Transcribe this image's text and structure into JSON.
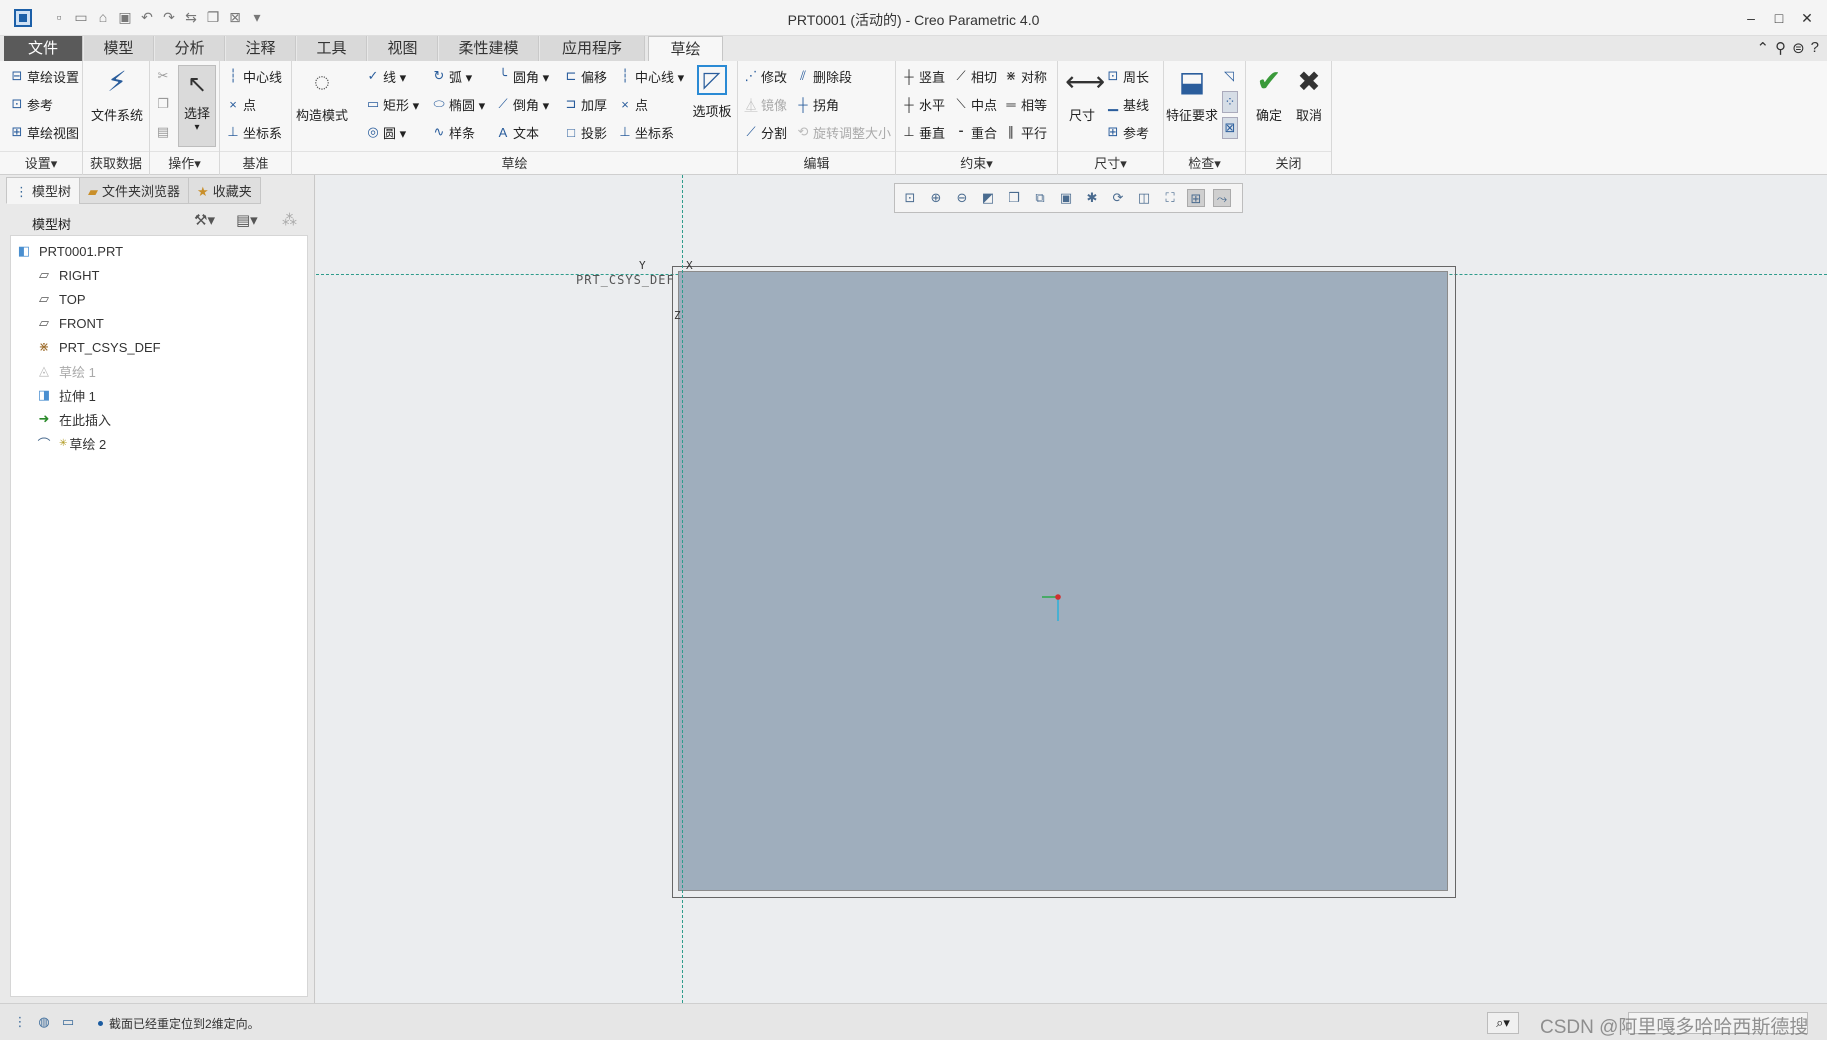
{
  "window": {
    "title": "PRT0001 (活动的) - Creo Parametric 4.0",
    "controls": [
      "–",
      "□",
      "✕"
    ]
  },
  "quick_access": [
    "new-icon",
    "open-icon",
    "save-icon",
    "undo-icon",
    "redo-icon",
    "regenerate-icon",
    "windows-icon",
    "close-icon",
    "customize-icon"
  ],
  "tabs": {
    "file": "文件",
    "model": "模型",
    "analysis": "分析",
    "annotate": "注释",
    "tools": "工具",
    "view": "视图",
    "flexible": "柔性建模",
    "apps": "应用程序",
    "sketch": "草绘"
  },
  "ribbon": {
    "setup": {
      "label": "设置▾",
      "sketch_setup": "草绘设置",
      "references": "参考",
      "sketch_view": "草绘视图"
    },
    "get_data": {
      "label": "获取数据",
      "file_system": "文件系统"
    },
    "operations": {
      "label": "操作▾",
      "select": "选择"
    },
    "datum": {
      "label": "基准",
      "centerline": "中心线",
      "point": "点",
      "csys": "坐标系"
    },
    "sketching": {
      "label": "草绘",
      "construction": "构造模式",
      "line": "线 ▾",
      "arc": "弧 ▾",
      "fillet": "圆角 ▾",
      "offset": "偏移",
      "centerline": "中心线 ▾",
      "rectangle": "矩形 ▾",
      "ellipse": "椭圆 ▾",
      "chamfer": "倒角 ▾",
      "thicken": "加厚",
      "point": "点",
      "circle": "圆 ▾",
      "spline": "样条",
      "text": "文本",
      "project": "投影",
      "csys": "坐标系",
      "palette": "选项板"
    },
    "editing": {
      "label": "编辑",
      "modify": "修改",
      "delete_segment": "删除段",
      "mirror": "镜像",
      "corner": "拐角",
      "divide": "分割",
      "rotate_resize": "旋转调整大小"
    },
    "constrain": {
      "label": "约束▾",
      "vertical": "竖直",
      "tangent": "相切",
      "symmetric": "对称",
      "horizontal": "水平",
      "midpoint": "中点",
      "equal": "相等",
      "perpendicular": "垂直",
      "coincident": "重合",
      "parallel": "平行"
    },
    "dimension": {
      "label": "尺寸▾",
      "dimension": "尺寸",
      "perimeter": "周长",
      "baseline": "基线",
      "reference": "参考"
    },
    "inspect": {
      "label": "检查▾",
      "feature_requirements": "特征要求"
    },
    "close": {
      "label": "关闭",
      "ok": "确定",
      "cancel": "取消"
    }
  },
  "navigator": {
    "tabs": [
      "模型树",
      "文件夹浏览器",
      "收藏夹"
    ],
    "tree_title": "模型树",
    "items": [
      {
        "label": "PRT0001.PRT",
        "icon": "part-icon"
      },
      {
        "label": "RIGHT",
        "icon": "datum-plane-icon"
      },
      {
        "label": "TOP",
        "icon": "datum-plane-icon"
      },
      {
        "label": "FRONT",
        "icon": "datum-plane-icon"
      },
      {
        "label": "PRT_CSYS_DEF",
        "icon": "csys-icon"
      },
      {
        "label": "草绘 1",
        "icon": "sketch-icon"
      },
      {
        "label": "拉伸 1",
        "icon": "extrude-icon"
      },
      {
        "label": "在此插入",
        "icon": "insert-here-icon"
      },
      {
        "label": "草绘 2",
        "icon": "active-sketch-icon"
      }
    ]
  },
  "graphics": {
    "csys_label": "PRT_CSYS_DEF",
    "axis_labels": {
      "x": "X",
      "y": "Y",
      "z": "Z"
    }
  },
  "status": {
    "message": "截面已经重定位到2维定向。",
    "watermark": "CSDN @阿里嘎多哈哈西斯德搜"
  },
  "colors": {
    "plane_fill": "#9faebd",
    "datum_line": "#2e9c8c",
    "accent": "#2a5d9c",
    "file_tab": "#5a5a5a"
  }
}
